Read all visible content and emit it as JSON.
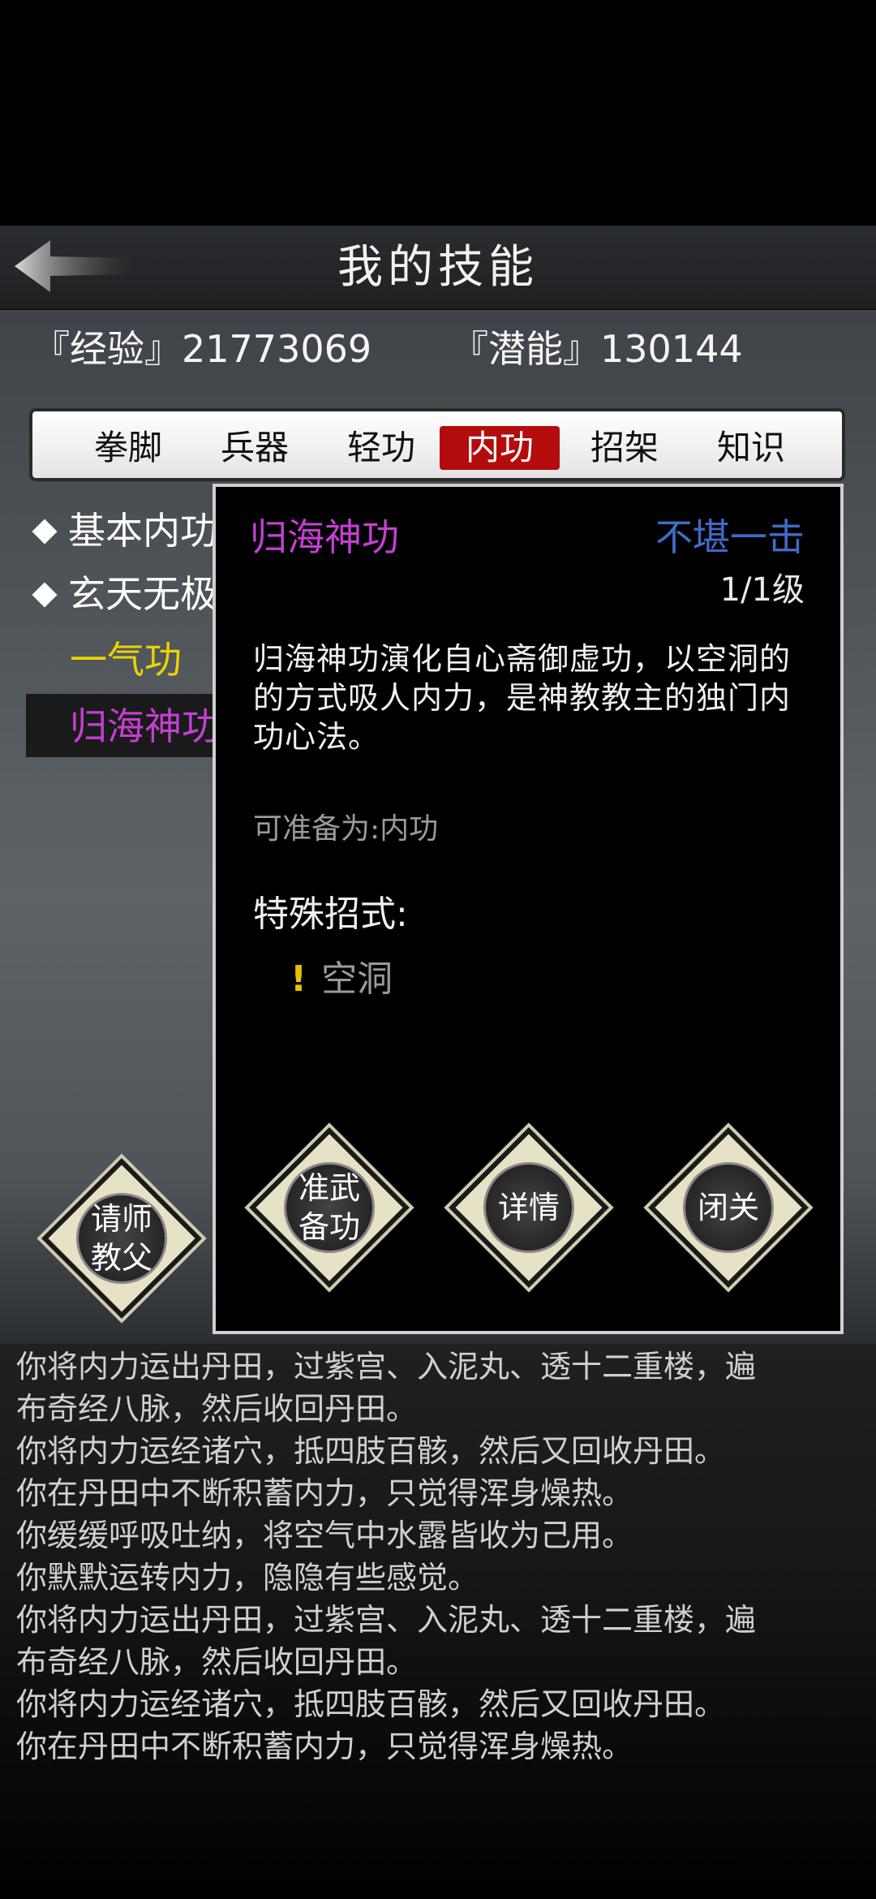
{
  "header": {
    "title": "我的技能"
  },
  "stats": {
    "exp": "『经验』21773069",
    "potential": "『潜能』130144"
  },
  "tabs": [
    {
      "label": "拳脚"
    },
    {
      "label": "兵器"
    },
    {
      "label": "轻功"
    },
    {
      "label": "内功",
      "active": true
    },
    {
      "label": "招架"
    },
    {
      "label": "知识"
    }
  ],
  "skills": [
    {
      "label": "基本内功",
      "color": "#ffffff"
    },
    {
      "label": "玄天无极",
      "color": "#ffffff"
    },
    {
      "label": "一气功",
      "color": "#e9d400"
    },
    {
      "label": "归海神功",
      "color": "#c33fd1",
      "selected": true
    }
  ],
  "master_button": {
    "label": "请师\n教父"
  },
  "popup": {
    "name": "归海神功",
    "rank": "不堪一击",
    "level": "1/1级",
    "description": "归海神功演化自心斋御虚功，以空洞的的方式吸人内力，是神教教主的独门内功心法。",
    "prep": "可准备为:内功",
    "special_title": "特殊招式:",
    "special_item": "空洞",
    "special_mark": "!",
    "buttons": {
      "equip": "准武\n备功",
      "detail": "详情",
      "retreat": "闭关"
    }
  },
  "log": [
    "你将内力运出丹田，过紫宫、入泥丸、透十二重楼，遍",
    "布奇经八脉，然后收回丹田。",
    "你将内力运经诸穴，抵四肢百骸，然后又回收丹田。",
    "你在丹田中不断积蓄内力，只觉得浑身燥热。",
    "你缓缓呼吸吐纳，将空气中水露皆收为己用。",
    "你默默运转内力，隐隐有些感觉。",
    "你将内力运出丹田，过紫宫、入泥丸、透十二重楼，遍",
    "布奇经八脉，然后收回丹田。",
    "你将内力运经诸穴，抵四肢百骸，然后又回收丹田。",
    "你在丹田中不断积蓄内力，只觉得浑身燥热。"
  ],
  "colors": {
    "active_tab": "#b40c0c",
    "popup_name": "#c33fd1",
    "popup_rank": "#3f6ac8"
  }
}
